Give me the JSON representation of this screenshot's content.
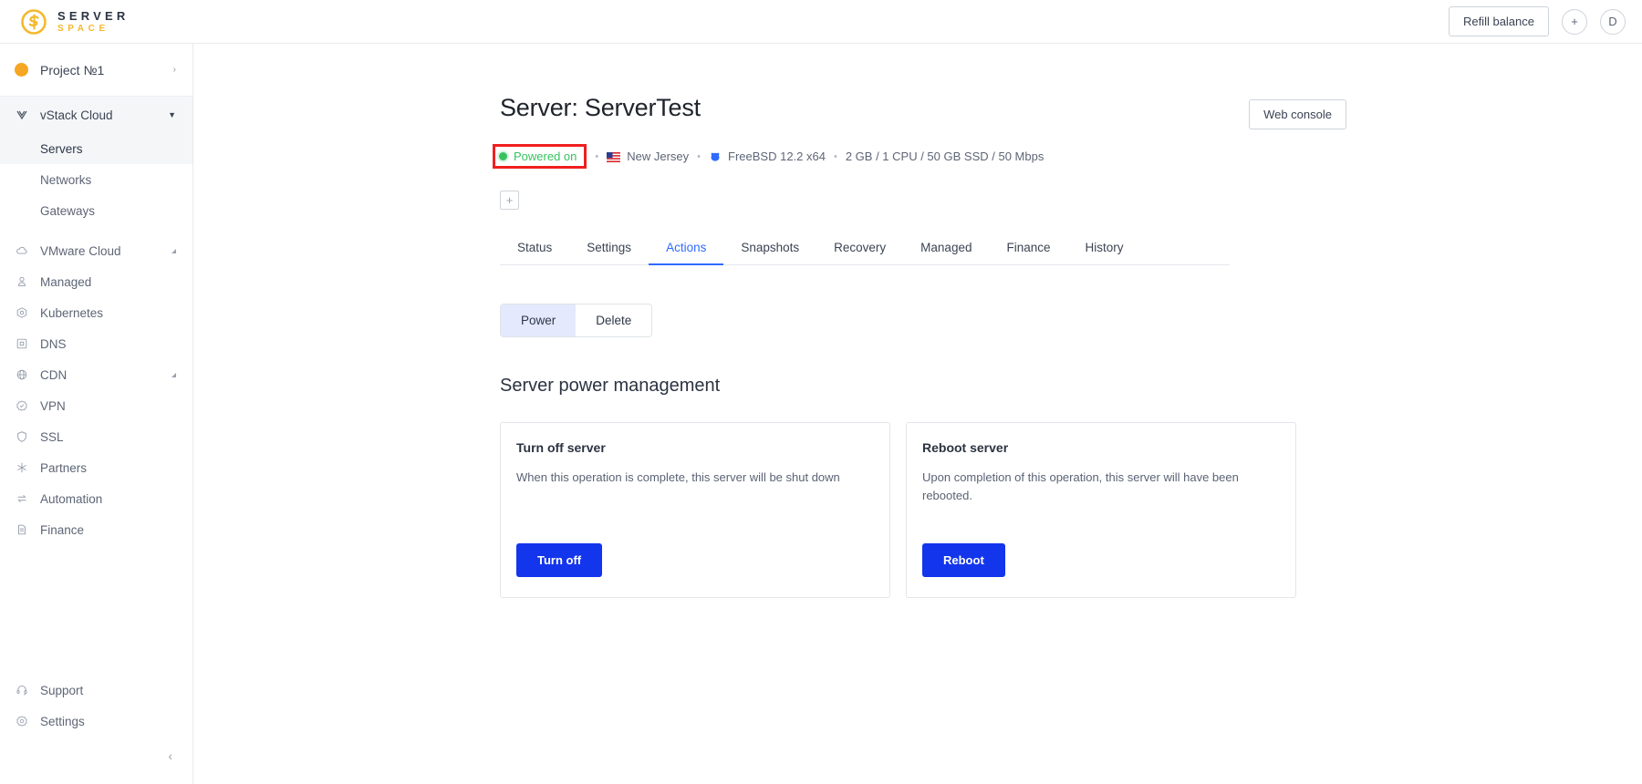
{
  "topbar": {
    "brand_top": "SERVER",
    "brand_bottom": "SPACE",
    "brand_icon": "serverspace-logo-icon",
    "refill_label": "Refill balance",
    "add_label": "+",
    "avatar_label": "D"
  },
  "sidebar": {
    "project": {
      "label": "Project №1",
      "icon": "project-dot-icon",
      "chevron": "›"
    },
    "group": {
      "label": "vStack Cloud",
      "icon": "vstack-icon",
      "caret": "▼"
    },
    "subitems": [
      {
        "label": "Servers",
        "active": true
      },
      {
        "label": "Networks",
        "active": false
      },
      {
        "label": "Gateways",
        "active": false
      }
    ],
    "items": [
      {
        "label": "VMware Cloud",
        "icon": "cloud-icon",
        "expandable": true
      },
      {
        "label": "Managed",
        "icon": "user-shield-icon",
        "expandable": false
      },
      {
        "label": "Kubernetes",
        "icon": "kubernetes-icon",
        "expandable": false
      },
      {
        "label": "DNS",
        "icon": "dns-icon",
        "expandable": false
      },
      {
        "label": "CDN",
        "icon": "globe-icon",
        "expandable": true
      },
      {
        "label": "VPN",
        "icon": "vpn-badge-icon",
        "expandable": false
      },
      {
        "label": "SSL",
        "icon": "shield-icon",
        "expandable": false
      },
      {
        "label": "Partners",
        "icon": "partners-icon",
        "expandable": false
      },
      {
        "label": "Automation",
        "icon": "automation-arrows-icon",
        "expandable": false
      },
      {
        "label": "Finance",
        "icon": "document-icon",
        "expandable": false
      }
    ],
    "bottom_items": [
      {
        "label": "Support",
        "icon": "headset-icon"
      },
      {
        "label": "Settings",
        "icon": "gear-icon"
      }
    ],
    "collapse_icon": "chevron-left-icon"
  },
  "page": {
    "title": "Server: ServerTest",
    "web_console_label": "Web console",
    "tag_add_label": "+",
    "status": "Powered on",
    "location": "New Jersey",
    "os": "FreeBSD 12.2 x64",
    "specs": "2 GB / 1 CPU / 50 GB SSD / 50 Mbps",
    "separator": "•",
    "highlight_color": "#f01f1f",
    "status_color": "#36c35f",
    "accent_color": "#2f6bff",
    "button_color": "#1335ec"
  },
  "tabs": [
    {
      "label": "Status",
      "active": false
    },
    {
      "label": "Settings",
      "active": false
    },
    {
      "label": "Actions",
      "active": true
    },
    {
      "label": "Snapshots",
      "active": false
    },
    {
      "label": "Recovery",
      "active": false
    },
    {
      "label": "Managed",
      "active": false
    },
    {
      "label": "Finance",
      "active": false
    },
    {
      "label": "History",
      "active": false
    }
  ],
  "segmented": [
    {
      "label": "Power",
      "active": true
    },
    {
      "label": "Delete",
      "active": false
    }
  ],
  "section": {
    "title": "Server power management"
  },
  "cards": [
    {
      "title": "Turn off server",
      "desc": "When this operation is complete, this server will be shut down",
      "button": "Turn off"
    },
    {
      "title": "Reboot server",
      "desc": "Upon completion of this operation, this server will have been rebooted.",
      "button": "Reboot"
    }
  ]
}
